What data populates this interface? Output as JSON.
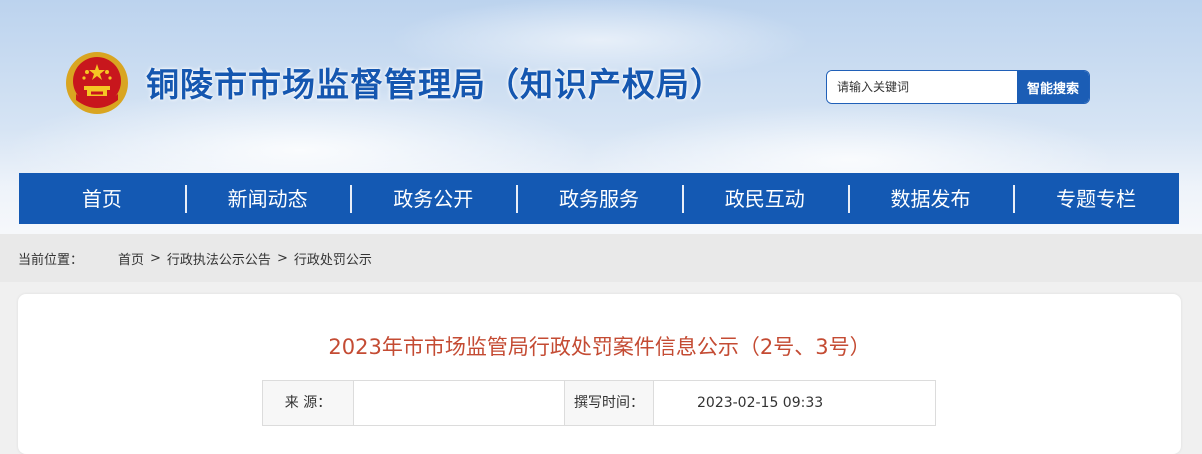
{
  "header": {
    "site_title": "铜陵市市场监督管理局（知识产权局）",
    "emblem_icon": "national-emblem-icon"
  },
  "search": {
    "placeholder": "请输入关键词",
    "button_label": "智能搜索"
  },
  "nav": {
    "items": [
      "首页",
      "新闻动态",
      "政务公开",
      "政务服务",
      "政民互动",
      "数据发布",
      "专题专栏"
    ]
  },
  "breadcrumb": {
    "label": "当前位置：",
    "items": [
      "首页",
      "行政执法公示公告",
      "行政处罚公示"
    ],
    "separator": ">"
  },
  "article": {
    "title": "2023年市市场监管局行政处罚案件信息公示（2号、3号）",
    "source_label": "来 源：",
    "source_value": "",
    "time_label": "撰写时间：",
    "time_value": "2023-02-15 09:33"
  },
  "colors": {
    "nav_bg": "#1459b3",
    "title_blue": "#1557b0",
    "article_title": "#c44b33"
  }
}
